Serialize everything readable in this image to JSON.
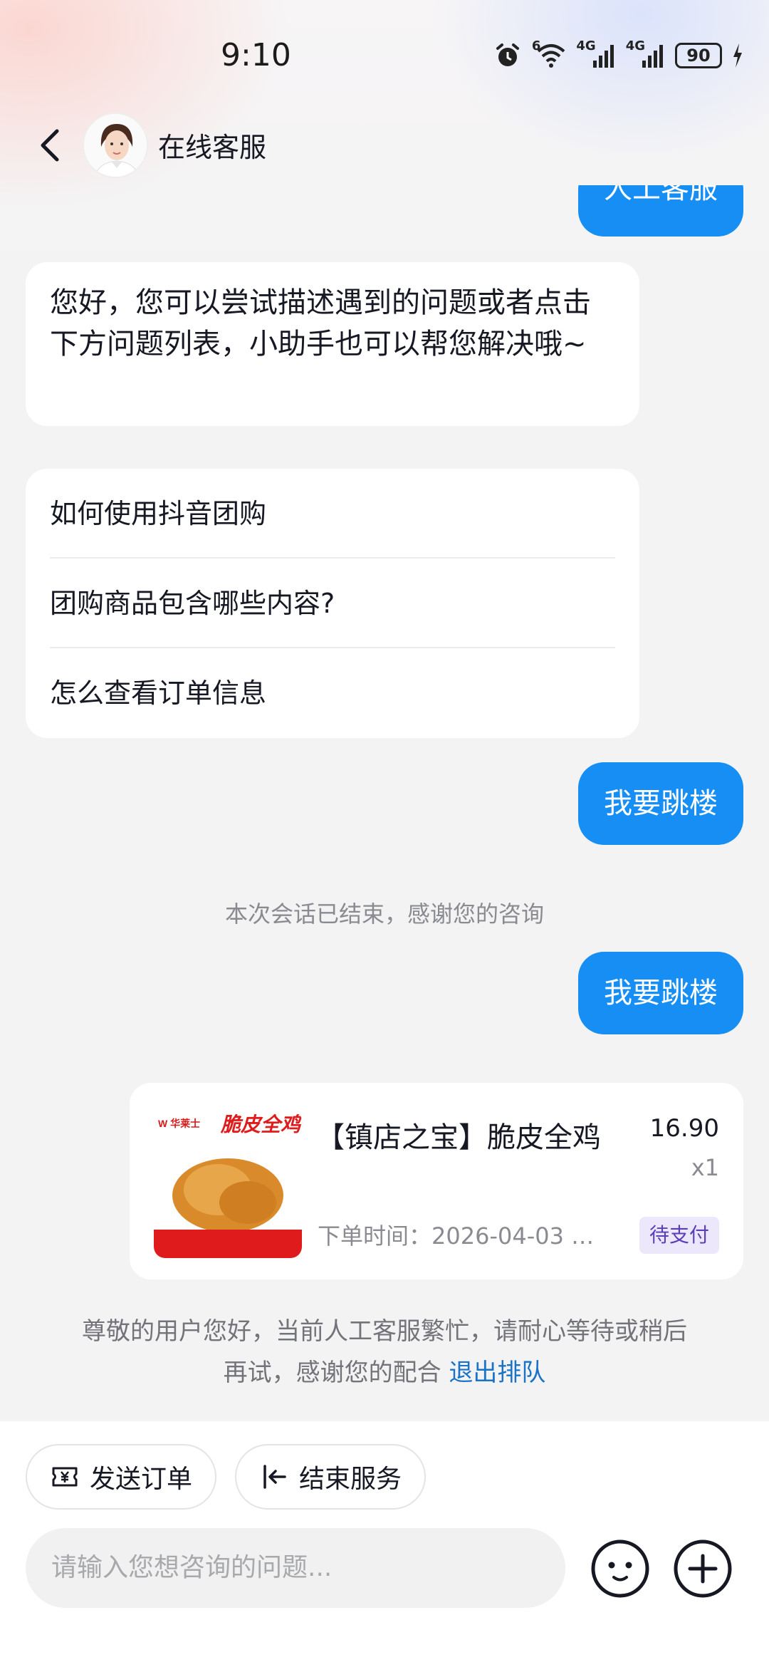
{
  "status_bar": {
    "time": "9:10",
    "battery": "90",
    "network_1": "4G",
    "network_2": "4G",
    "wifi_label": "6"
  },
  "header": {
    "title": "在线客服"
  },
  "messages": {
    "top_outgoing": "人工客服",
    "greeting": "您好，您可以尝试描述遇到的问题或者点击下方问题列表，小助手也可以帮您解决哦~",
    "questions": [
      "如何使用抖音团购",
      "团购商品包含哪些内容?",
      "怎么查看订单信息"
    ],
    "outgoing_1": "我要跳楼",
    "system": "本次会话已结束，感谢您的咨询",
    "outgoing_2": "我要跳楼"
  },
  "order": {
    "title": "【镇店之宝】脆皮全鸡",
    "price": "16.90",
    "qty": "x1",
    "time": "下单时间：2026-04-03 …",
    "status": "待支付",
    "image_text": "脆皮全鸡",
    "brand": "W 华莱士"
  },
  "queue_note": {
    "text": "尊敬的用户您好，当前人工客服繁忙，请耐心等待或稍后再试，感谢您的配合",
    "link": "退出排队"
  },
  "bottom": {
    "send_order": "发送订单",
    "end_service": "结束服务",
    "input_placeholder": "请输入您想咨询的问题..."
  },
  "colors": {
    "accent": "#168ef4",
    "link": "#1a73c7",
    "badge_bg": "#ece7fb"
  }
}
